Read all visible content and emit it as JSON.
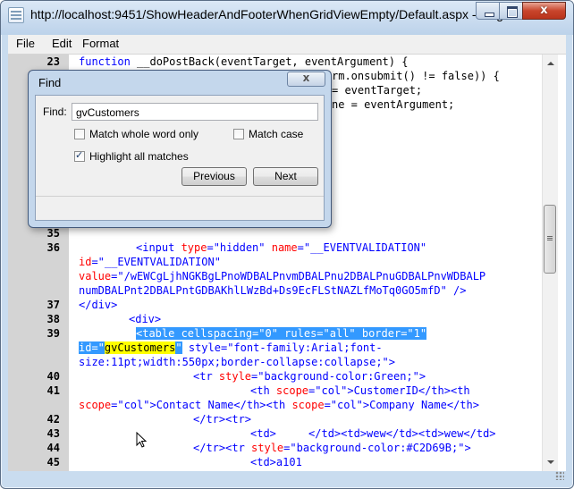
{
  "window": {
    "title": "http://localhost:9451/ShowHeaderAndFooterWhenGridViewEmpty/Default.aspx - Origin...",
    "close_glyph": "x"
  },
  "menu": [
    "File",
    "Edit",
    "Format"
  ],
  "find_dialog": {
    "title": "Find",
    "close_glyph": "x",
    "find_label": "Find:",
    "find_value": "gvCustomers",
    "match_whole_word": {
      "label": "Match whole word only",
      "checked": false
    },
    "match_case": {
      "label": "Match case",
      "checked": false
    },
    "highlight_all": {
      "label": "Highlight all matches",
      "checked": true
    },
    "previous_label": "Previous",
    "next_label": "Next"
  },
  "code": {
    "line_numbers": [
      "23",
      "35",
      "36",
      "37",
      "38",
      "39",
      "40",
      "41",
      "42",
      "43",
      "44",
      "45"
    ],
    "line23": {
      "keyword": "function",
      "rest": " __doPostBack(eventTarget, eventArgument) {"
    },
    "line24_tail": "rm.onsubmit() != false)) {",
    "line25_tail": "= eventTarget;",
    "line26_tail": "ne = eventArgument;",
    "line36": {
      "a": "<input ",
      "a_attr": "type",
      "a_val": "=\"hidden\" ",
      "b_attr": "name",
      "b_val": "=\"__EVENTVALIDATION\"",
      "c_attr": "id",
      "c_val": "=\"__EVENTVALIDATION\"",
      "d_attr": "value",
      "d_val1": "=\"/wEWCgLjhNGKBgLPnoWDBALPnvmDBALPnu2DBALPnuGDBALPnvWDBALP",
      "d_val2": "numDBALPnt2DBALPntGDBAKhlLWzBd+Ds9EcFLStNAZLfMoTq0GO5mfD\"",
      "close": " />"
    },
    "line37": "</div>",
    "line38": "<div>",
    "line39": {
      "selected": "<table cellspacing=\"0\" rules=\"all\" border=\"1\"",
      "sel_id": "id=\"",
      "match": "gvCustomers",
      "sel_quote": "\"",
      "rest1": " style=\"font-family:Arial;font-",
      "rest2": "size:11pt;width:550px;border-collapse:collapse;\">"
    },
    "line40": {
      "tag": "<tr ",
      "attr": "style",
      "val": "=\"background-color:Green;\"",
      "close": ">"
    },
    "line41": {
      "tag": "<th ",
      "attr": "scope",
      "val": "=\"col\"",
      "text": ">CustomerID</th><th"
    },
    "line41b": {
      "attr": "scope",
      "val": "=\"col\"",
      "text1": ">Contact Name</th><th ",
      "attr2": "scope",
      "val2": "=\"col\"",
      "text2": ">Company Name</th>"
    },
    "line42": "</tr><tr>",
    "line43": "<td>     </td><td>wew</td><td>wew</td>",
    "line44": {
      "tag": "</tr><tr ",
      "attr": "style",
      "val": "=\"background-color:#C2D69B;\"",
      "close": ">"
    },
    "line45": "<td>a101"
  }
}
